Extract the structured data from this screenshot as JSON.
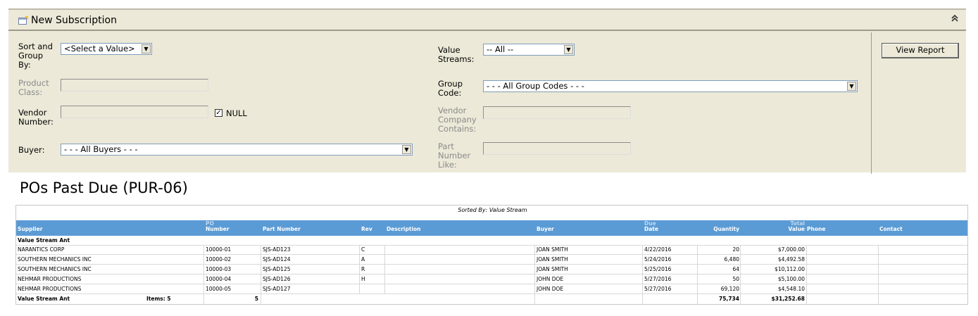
{
  "panel": {
    "title": "New Subscription",
    "collapse_glyph": "«",
    "fields": {
      "sort_group_label_1": "Sort and",
      "sort_group_label_2": "Group",
      "sort_group_label_3": "By:",
      "sort_group_value": "<Select a Value>",
      "product_class_label_1": "Product",
      "product_class_label_2": "Class:",
      "vendor_number_label_1": "Vendor",
      "vendor_number_label_2": "Number:",
      "null_label": "NULL",
      "null_checked": "✓",
      "buyer_label": "Buyer:",
      "buyer_value": "- - - All Buyers - - -",
      "value_streams_label_1": "Value",
      "value_streams_label_2": "Streams:",
      "value_streams_value": "-- All --",
      "group_code_label_1": "Group",
      "group_code_label_2": "Code:",
      "group_code_value": "- - - All Group Codes - - -",
      "vendor_company_label_1": "Vendor",
      "vendor_company_label_2": "Company",
      "vendor_company_label_3": "Contains:",
      "part_number_label_1": "Part",
      "part_number_label_2": "Number",
      "part_number_label_3": "Like:"
    },
    "view_report_label": "View Report",
    "dropdown_arrow": "▼"
  },
  "report": {
    "title": "POs Past Due (PUR-06)",
    "sorted_by": "Sorted By: Value Stream",
    "columns": {
      "supplier": "Supplier",
      "po_top": "PO",
      "po_bottom": "Number",
      "part_number": "Part Number",
      "rev": "Rev",
      "description": "Description",
      "buyer": "Buyer",
      "due_top": "Due",
      "due_bottom": "Date",
      "quantity": "Quantity",
      "total_top": "Total",
      "total_bottom": "Value",
      "phone": "Phone",
      "contact": "Contact"
    },
    "group_label": "Value Stream  Ant",
    "rows": [
      {
        "supplier": "NARANTICS CORP",
        "po": "10000-01",
        "part": "SJS-AD123",
        "rev": "C",
        "buyer": "JOAN SMITH",
        "due": "4/22/2016",
        "qty": "20",
        "total": "$7,000.00"
      },
      {
        "supplier": "SOUTHERN MECHANICS INC",
        "po": "10000-02",
        "part": "SJS-AD124",
        "rev": "A",
        "buyer": "JOAN SMITH",
        "due": "5/24/2016",
        "qty": "6,480",
        "total": "$4,492.58"
      },
      {
        "supplier": "SOUTHERN MECHANICS INC",
        "po": "10000-03",
        "part": "SJS-AD125",
        "rev": "R",
        "buyer": "JOAN SMITH",
        "due": "5/25/2016",
        "qty": "64",
        "total": "$10,112.00"
      },
      {
        "supplier": "NEHMAR PRODUCTIONS",
        "po": "10000-04",
        "part": "SJS-AD126",
        "rev": "H",
        "buyer": "JOHN DOE",
        "due": "5/27/2016",
        "qty": "50",
        "total": "$5,100.00"
      },
      {
        "supplier": "NEHMAR PRODUCTIONS",
        "po": "10000-05",
        "part": "SJS-AD127",
        "rev": "",
        "buyer": "JOHN DOE",
        "due": "5/27/2016",
        "qty": "69,120",
        "total": "$4,548.10"
      }
    ],
    "footer": {
      "label": "Value Stream  Ant",
      "items_label": "Items: 5",
      "po_count": "5",
      "qty_total": "75,734",
      "value_total": "$31,252.68"
    }
  },
  "colors": {
    "panel_bg": "#ECE9D8",
    "header_band": "#5B9BD5"
  }
}
